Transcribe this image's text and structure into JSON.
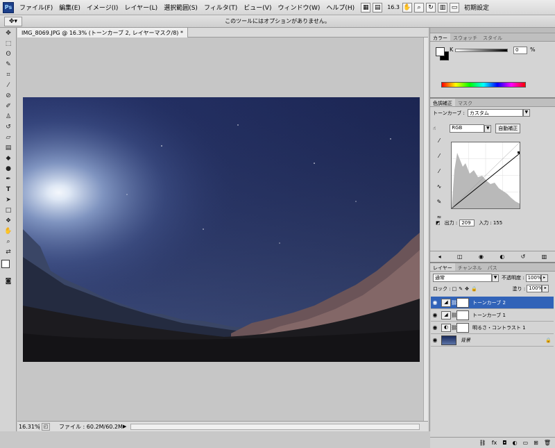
{
  "app": {
    "logo": "Ps"
  },
  "menu": [
    "ファイル(F)",
    "編集(E)",
    "イメージ(I)",
    "レイヤー(L)",
    "選択範囲(S)",
    "フィルタ(T)",
    "ビュー(V)",
    "ウィンドウ(W)",
    "ヘルプ(H)"
  ],
  "menubar_controls": {
    "zoom": "16.3",
    "workspace": "初期設定"
  },
  "options_bar": {
    "message": "このツールにはオプションがありません。"
  },
  "document": {
    "tab_title": "IMG_8069.JPG @ 16.3% (トーンカーブ 2, レイヤーマスク/8) *",
    "status_zoom": "16.31%",
    "status_info": "ファイル : 60.2M/60.2M"
  },
  "panels": {
    "color": {
      "tabs": [
        "カラー",
        "スウォッチ",
        "スタイル"
      ],
      "channel_label": "K",
      "value": "0",
      "unit": "%"
    },
    "adjustments": {
      "tabs": [
        "色調補正",
        "マスク"
      ],
      "preset_label": "トーンカーブ :",
      "preset_value": "カスタム",
      "channel": "RGB",
      "auto_button": "自動補正",
      "output_label": "出力 :",
      "output_value": "209",
      "input_label": "入力 :",
      "input_value": "155"
    },
    "layers": {
      "tabs": [
        "レイヤー",
        "チャンネル",
        "パス"
      ],
      "blend_mode": "通常",
      "opacity_label": "不透明度 :",
      "opacity": "100%",
      "lock_label": "ロック :",
      "fill_label": "塗り :",
      "fill": "100%",
      "items": [
        {
          "name": "トーンカーブ 2",
          "selected": true
        },
        {
          "name": "トーンカーブ 1",
          "selected": false
        },
        {
          "name": "明るさ・コントラスト 1",
          "selected": false
        },
        {
          "name": "背景",
          "selected": false
        }
      ]
    }
  },
  "colors": {
    "selection": "#3163b8",
    "sky_dark": "#141b40",
    "moon_glow": "#dfe8f5"
  }
}
